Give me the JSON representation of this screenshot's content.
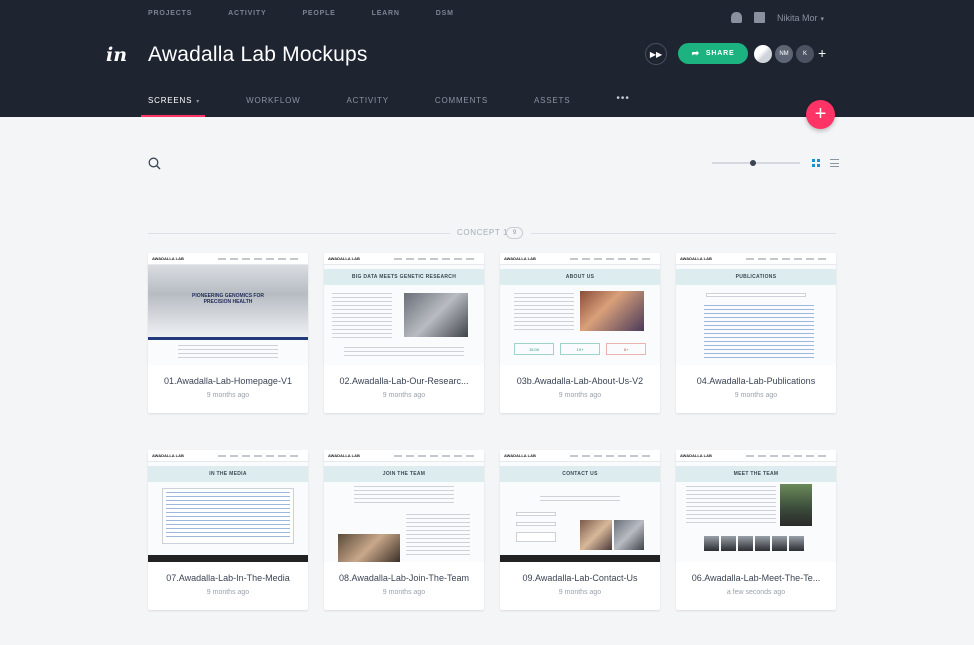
{
  "topnav": [
    "PROJECTS",
    "ACTIVITY",
    "PEOPLE",
    "LEARN",
    "DSM"
  ],
  "user": {
    "name": "Nikita Mor",
    "icons": [
      "bell-icon",
      "gift-icon",
      "chevron-down-icon"
    ]
  },
  "logo": "in",
  "project_title": "Awadalla Lab Mockups",
  "share_label": "SHARE",
  "collaborators": [
    {
      "initials": ""
    },
    {
      "initials": "NM"
    },
    {
      "initials": "K"
    }
  ],
  "add_collaborator": "+",
  "tabs": [
    {
      "label": "SCREENS",
      "active": true
    },
    {
      "label": "WORKFLOW",
      "active": false
    },
    {
      "label": "ACTIVITY",
      "active": false
    },
    {
      "label": "COMMENTS",
      "active": false
    },
    {
      "label": "ASSETS",
      "active": false
    }
  ],
  "more_label": "•••",
  "fab_label": "+",
  "section": {
    "label": "CONCEPT 1",
    "count": "9"
  },
  "colors": {
    "header_bg": "#1f2431",
    "accent_pink": "#ff3366",
    "share_green": "#1db381",
    "grid_icon_blue": "#1a8fd1"
  },
  "screens": [
    {
      "name": "01.Awadalla-Lab-Homepage-V1",
      "time": "9 months ago",
      "thumb_text": "PIONEERING GENOMICS FOR PRECISION HEALTH"
    },
    {
      "name": "02.Awadalla-Lab-Our-Researc...",
      "time": "9 months ago",
      "thumb_text": "BIG DATA MEETS GENETIC RESEARCH"
    },
    {
      "name": "03b.Awadalla-Lab-About-Us-V2",
      "time": "9 months ago",
      "thumb_text": "ABOUT US"
    },
    {
      "name": "04.Awadalla-Lab-Publications",
      "time": "9 months ago",
      "thumb_text": "PUBLICATIONS"
    },
    {
      "name": "07.Awadalla-Lab-In-The-Media",
      "time": "9 months ago",
      "thumb_text": "IN THE MEDIA"
    },
    {
      "name": "08.Awadalla-Lab-Join-The-Team",
      "time": "9 months ago",
      "thumb_text": "JOIN THE TEAM"
    },
    {
      "name": "09.Awadalla-Lab-Contact-Us",
      "time": "9 months ago",
      "thumb_text": "CONTACT US"
    },
    {
      "name": "06.Awadalla-Lab-Meet-The-Te...",
      "time": "a few seconds ago",
      "thumb_text": "MEET THE TEAM"
    }
  ],
  "thumb_logo": "AWADALLA LAB",
  "stats": [
    "15.00",
    "10+",
    "8+"
  ]
}
